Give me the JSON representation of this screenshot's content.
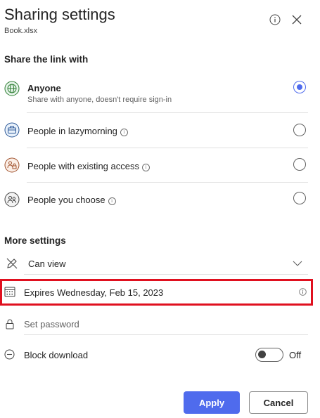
{
  "header": {
    "title": "Sharing settings",
    "file_name": "Book.xlsx"
  },
  "share_section": {
    "heading": "Share the link with",
    "options": [
      {
        "label": "Anyone",
        "description": "Share with anyone, doesn't require sign-in",
        "selected": true,
        "icon": "globe-icon"
      },
      {
        "label": "People in lazymorning",
        "selected": false,
        "icon": "briefcase-icon"
      },
      {
        "label": "People with existing access",
        "selected": false,
        "icon": "people-lock-icon"
      },
      {
        "label": "People you choose",
        "selected": false,
        "icon": "people-icon"
      }
    ]
  },
  "more_settings": {
    "heading": "More settings",
    "permission": {
      "value": "Can view"
    },
    "expires": {
      "label": "Expires Wednesday, Feb 15, 2023"
    },
    "password": {
      "placeholder": "Set password"
    },
    "block_download": {
      "label": "Block download",
      "state": "Off"
    }
  },
  "buttons": {
    "apply": "Apply",
    "cancel": "Cancel"
  },
  "colors": {
    "accent": "#4f6bed",
    "highlight": "#e0101f"
  }
}
